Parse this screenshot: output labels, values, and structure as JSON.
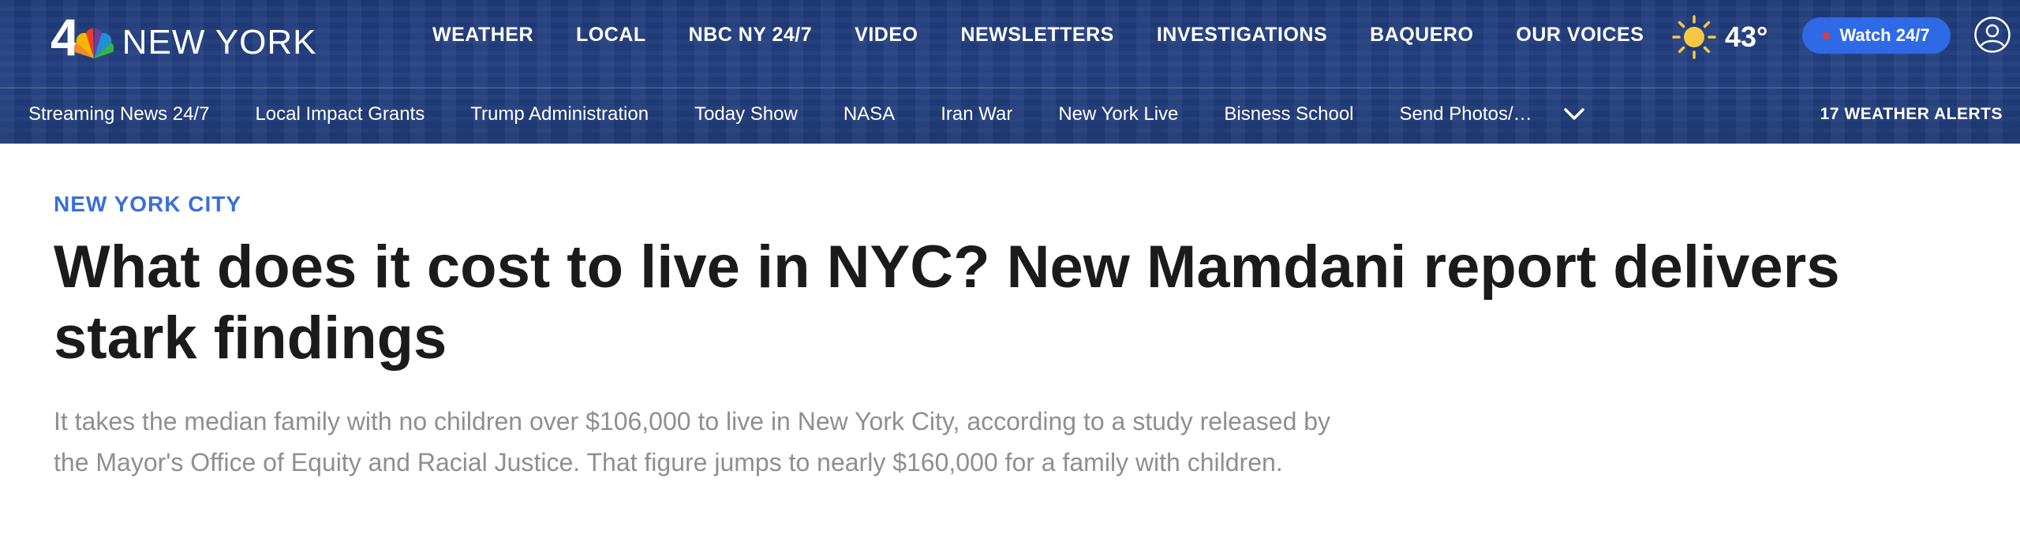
{
  "logo": {
    "channel_number": "4",
    "city": "NEW YORK",
    "icon": "nbc-peacock-icon"
  },
  "primary_nav": [
    "WEATHER",
    "LOCAL",
    "NBC NY 24/7",
    "VIDEO",
    "NEWSLETTERS",
    "INVESTIGATIONS",
    "BAQUERO",
    "OUR VOICES"
  ],
  "weather": {
    "icon": "sun-icon",
    "temperature": "43°"
  },
  "watch_button": {
    "label": "Watch 24/7",
    "icon": "live-dot-icon"
  },
  "account": {
    "icon": "user-account-icon"
  },
  "secondary_nav": {
    "items": [
      "Streaming News 24/7",
      "Local Impact Grants",
      "Trump Administration",
      "Today Show",
      "NASA",
      "Iran War",
      "New York Live",
      "Bisness School",
      "Send Photos/…"
    ],
    "more_icon": "chevron-down-icon"
  },
  "alerts": "17 WEATHER ALERTS",
  "article": {
    "category": "NEW YORK CITY",
    "headline": "What does it cost to live in NYC? New Mamdani report delivers stark findings",
    "dek": "It takes the median family with no children over $106,000 to live in New York City, according to a study released by the Mayor's Office of Equity and Racial Justice. That figure jumps to nearly $160,000 for a family with children."
  },
  "colors": {
    "masthead": "#1f3a78",
    "accent_blue": "#2f6ae6",
    "category_blue": "#3a6fd8",
    "dek_gray": "#8f8f8f",
    "sun_yellow": "#f6c744"
  }
}
